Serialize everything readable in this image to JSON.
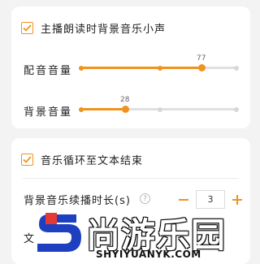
{
  "section1": {
    "checkbox_checked": true,
    "checkbox_label": "主播朗读时背景音乐小声",
    "dubbing_volume": {
      "label": "配音音量",
      "value": "77",
      "fraction": 0.77
    },
    "bg_volume": {
      "label": "背景音量",
      "value": "28",
      "fraction": 0.28
    }
  },
  "section2": {
    "checkbox_checked": true,
    "checkbox_label": "音乐循环至文本结束",
    "duration_label": "背景音乐续播时长(s)",
    "help_icon": "?",
    "stepper": {
      "minus": "−",
      "value": "3",
      "plus": "+"
    },
    "partial_label": "文"
  },
  "watermark": {
    "text": "尚游乐园",
    "sub": "SHYIYUANYK.COM"
  },
  "colors": {
    "accent": "#f0931e",
    "track": "#e0e0e0",
    "background": "#f3f3f3"
  }
}
